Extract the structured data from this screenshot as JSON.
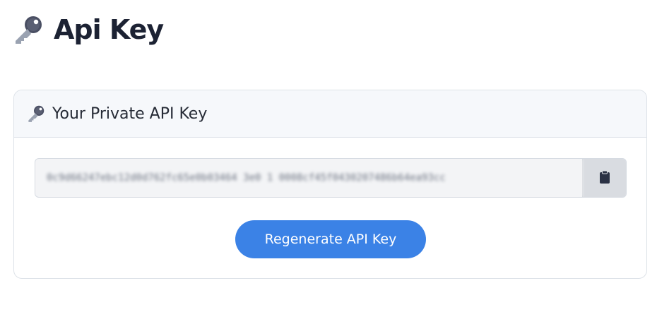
{
  "page": {
    "title": "Api Key",
    "icon": "key-icon"
  },
  "card": {
    "title": "Your Private API Key",
    "icon": "key-icon",
    "api_key_value": "0c9d66247ebc12d0d762fc65e0b03464 3e0 1 0008cf45f0430207486b64ea93cc",
    "copy_icon": "clipboard-icon",
    "regenerate_label": "Regenerate API Key"
  },
  "colors": {
    "accent": "#3b82e6",
    "icon_metal": "#8a93a3",
    "icon_dark": "#3a3f55"
  }
}
